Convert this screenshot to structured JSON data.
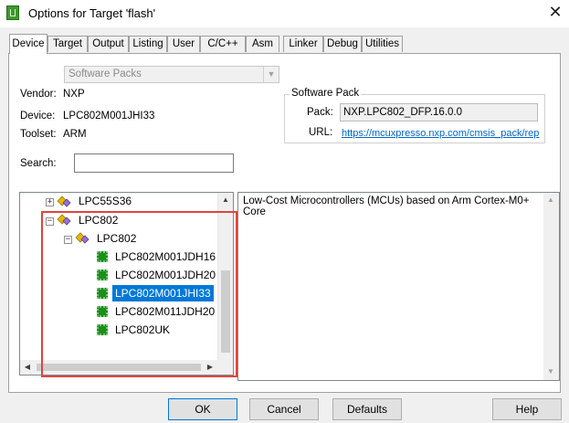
{
  "window": {
    "title": "Options for Target 'flash'",
    "close_glyph": "✕"
  },
  "tabs": [
    "Device",
    "Target",
    "Output",
    "Listing",
    "User",
    "C/C++",
    "Asm",
    "Linker",
    "Debug",
    "Utilities"
  ],
  "device_tab": {
    "packs_combo": "Software Packs",
    "vendor_label": "Vendor:",
    "vendor_value": "NXP",
    "device_label": "Device:",
    "device_value": "LPC802M001JHI33",
    "toolset_label": "Toolset:",
    "toolset_value": "ARM",
    "search_label": "Search:",
    "search_value": "",
    "software_pack": {
      "group_title": "Software Pack",
      "pack_label": "Pack:",
      "pack_value": "NXP.LPC802_DFP.16.0.0",
      "url_label": "URL:",
      "url_value": "https://mcuxpresso.nxp.com/cmsis_pack/rep"
    },
    "tree": [
      {
        "label": "LPC55S36",
        "level": 0,
        "kind": "family",
        "expander": "+"
      },
      {
        "label": "LPC802",
        "level": 0,
        "kind": "family",
        "expander": "−"
      },
      {
        "label": "LPC802",
        "level": 1,
        "kind": "subfamily",
        "expander": "−"
      },
      {
        "label": "LPC802M001JDH16",
        "level": 2,
        "kind": "device"
      },
      {
        "label": "LPC802M001JDH20",
        "level": 2,
        "kind": "device"
      },
      {
        "label": "LPC802M001JHI33",
        "level": 2,
        "kind": "device",
        "selected": true
      },
      {
        "label": "LPC802M011JDH20",
        "level": 2,
        "kind": "device"
      },
      {
        "label": "LPC802UK",
        "level": 2,
        "kind": "device"
      }
    ],
    "description": "Low-Cost Microcontrollers (MCUs) based on Arm Cortex-M0+ Core"
  },
  "buttons": {
    "ok": "OK",
    "cancel": "Cancel",
    "defaults": "Defaults",
    "help": "Help"
  },
  "colors": {
    "selection": "#0078d7",
    "highlight_box": "#e0443e",
    "link": "#0066cc"
  }
}
